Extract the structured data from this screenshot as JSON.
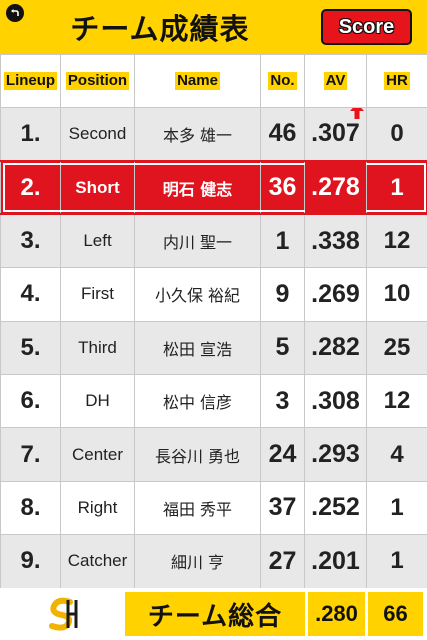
{
  "header": {
    "title": "チーム成績表",
    "score_label": "Score"
  },
  "columns": {
    "lineup": "Lineup",
    "position": "Position",
    "name": "Name",
    "no": "No.",
    "av": "AV",
    "hr": "HR"
  },
  "rows": [
    {
      "lineup": "1.",
      "position": "Second",
      "name": "本多 雄一",
      "no": "46",
      "av": ".307",
      "hr": "0"
    },
    {
      "lineup": "2.",
      "position": "Short",
      "name": "明石 健志",
      "no": "36",
      "av": ".278",
      "hr": "1"
    },
    {
      "lineup": "3.",
      "position": "Left",
      "name": "内川 聖一",
      "no": "1",
      "av": ".338",
      "hr": "12"
    },
    {
      "lineup": "4.",
      "position": "First",
      "name": "小久保 裕紀",
      "no": "9",
      "av": ".269",
      "hr": "10"
    },
    {
      "lineup": "5.",
      "position": "Third",
      "name": "松田 宣浩",
      "no": "5",
      "av": ".282",
      "hr": "25"
    },
    {
      "lineup": "6.",
      "position": "DH",
      "name": "松中 信彦",
      "no": "3",
      "av": ".308",
      "hr": "12"
    },
    {
      "lineup": "7.",
      "position": "Center",
      "name": "長谷川 勇也",
      "no": "24",
      "av": ".293",
      "hr": "4"
    },
    {
      "lineup": "8.",
      "position": "Right",
      "name": "福田 秀平",
      "no": "37",
      "av": ".252",
      "hr": "1"
    },
    {
      "lineup": "9.",
      "position": "Catcher",
      "name": "細川 亨",
      "no": "27",
      "av": ".201",
      "hr": "1"
    }
  ],
  "selected_row": 2,
  "footer": {
    "total_label": "チーム総合",
    "total_av": ".280",
    "total_hr": "66",
    "logo_text": "SH"
  },
  "colors": {
    "accent_yellow": "#ffd200",
    "selected_red": "#e0141e",
    "button_red": "#e8141c",
    "trend_up_red": "#e8141c",
    "logo_gold": "#f2b200"
  },
  "icons": {
    "back": "back-arrow-icon",
    "trend": "trend-up-icon",
    "logo": "team-logo"
  }
}
